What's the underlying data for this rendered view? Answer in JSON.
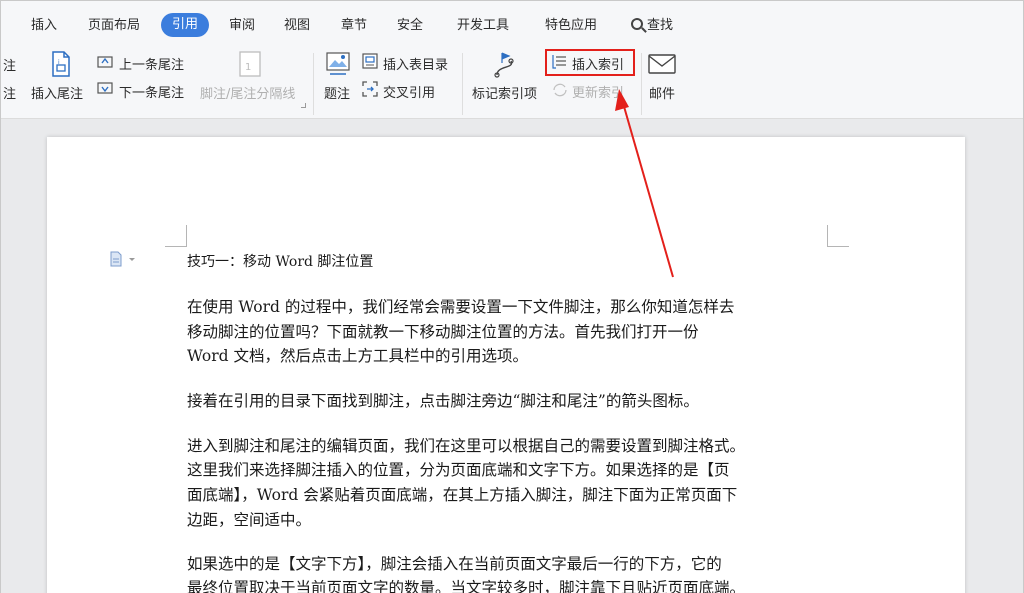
{
  "tabs": [
    {
      "id": "insert",
      "label": "插入"
    },
    {
      "id": "layout",
      "label": "页面布局"
    },
    {
      "id": "references",
      "label": "引用"
    },
    {
      "id": "review",
      "label": "审阅"
    },
    {
      "id": "view",
      "label": "视图"
    },
    {
      "id": "section",
      "label": "章节"
    },
    {
      "id": "security",
      "label": "安全"
    },
    {
      "id": "devtools",
      "label": "开发工具"
    },
    {
      "id": "special",
      "label": "特色应用"
    },
    {
      "id": "find",
      "label": "查找"
    }
  ],
  "active_tab": "引用",
  "ribbon": {
    "partial_top": "注",
    "partial_bottom": "注",
    "insert_endnote": "插入尾注",
    "prev_endnote": "上一条尾注",
    "next_endnote": "下一条尾注",
    "footnote_separator": "脚注/尾注分隔线",
    "caption": "题注",
    "insert_table_of_figures": "插入表目录",
    "cross_reference": "交叉引用",
    "mark_entry": "标记索引项",
    "insert_index": "插入索引",
    "update_index": "更新索引",
    "mail": "邮件"
  },
  "document": {
    "title": "技巧一：移动 Word 脚注位置",
    "lines": [
      "在使用 Word 的过程中，我们经常会需要设置一下文件脚注，那么你知道怎样去",
      "移动脚注的位置吗？下面就教一下移动脚注位置的方法。首先我们打开一份",
      "Word 文档，然后点击上方工具栏中的引用选项。",
      "接着在引用的目录下面找到脚注，点击脚注旁边“脚注和尾注”的箭头图标。",
      "进入到脚注和尾注的编辑页面，我们在这里可以根据自己的需要设置到脚注格式。",
      "这里我们来选择脚注插入的位置，分为页面底端和文字下方。如果选择的是【页",
      "面底端】，Word 会紧贴着页面底端，在其上方插入脚注，脚注下面为正常页面下",
      "边距，空间适中。",
      "如果选中的是【文字下方】，脚注会插入在当前页面文字最后一行的下方，它的",
      "最终位置取决于当前页面文字的数量。当文字较多时，脚注靠下且贴近页面底端。"
    ]
  },
  "colors": {
    "accent": "#3b7ddd",
    "highlight": "#e3201b",
    "arrow": "#e3201b"
  }
}
